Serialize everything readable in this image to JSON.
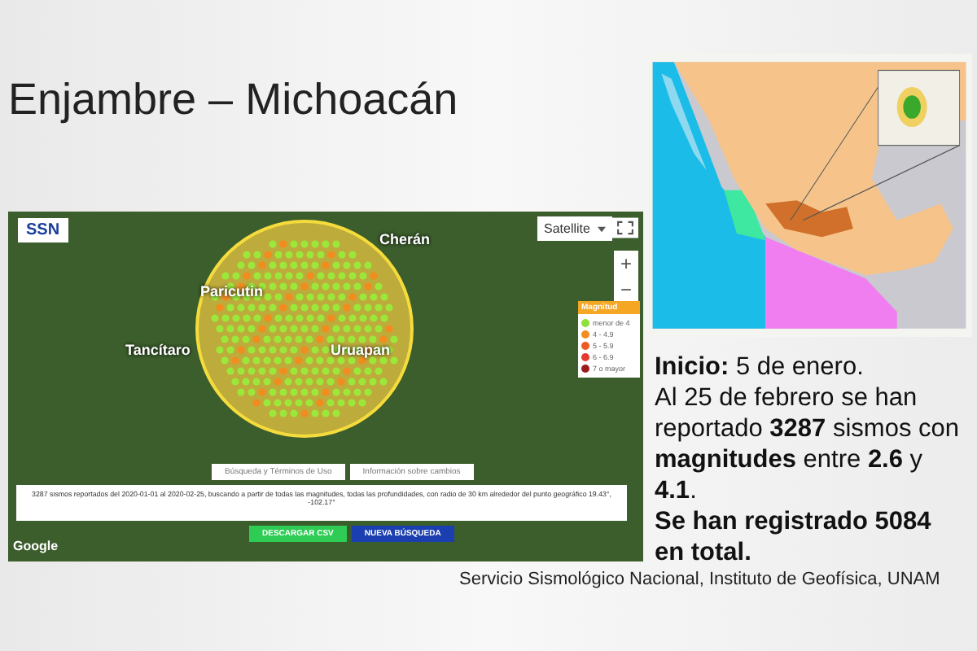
{
  "slide": {
    "title": "Enjambre – Michoacán",
    "seismic_map": {
      "logo": "SSN",
      "map_type": "Satellite",
      "zoom_in": "+",
      "zoom_out": "−",
      "places": [
        "Cherán",
        "Paricutin",
        "Tancítaro",
        "Uruapan"
      ],
      "legend": {
        "title": "Magnitud",
        "items": [
          {
            "label": "menor de 4",
            "color": "#8ee03a"
          },
          {
            "label": "4 - 4.9",
            "color": "#f28c1e"
          },
          {
            "label": "5 - 5.9",
            "color": "#ee5a24"
          },
          {
            "label": "6 - 6.9",
            "color": "#e53a2f"
          },
          {
            "label": "7 o mayor",
            "color": "#9b1c1c"
          }
        ]
      },
      "links": [
        "Búsqueda y Términos de Uso",
        "Información sobre cambios"
      ],
      "summary": "3287 sismos reportados del 2020-01-01 al 2020-02-25, buscando a partir de todas las magnitudes, todas las profundidades, con radio de 30 km alrededor del punto geográfico 19.43°, -102.17°",
      "buttons": [
        {
          "label": "DESCARGAR CSV",
          "kind": "download"
        },
        {
          "label": "NUEVA BÚSQUEDA",
          "kind": "search"
        }
      ],
      "attribution": "Google"
    },
    "paragraphs": [
      {
        "text": "**Inicio:** 5 de enero.",
        "kind": "plain"
      },
      {
        "text": "Al 25 de febrero se han reportado **3287** sismos con **magnitudes** entre **2.6** y **4.1**.",
        "kind": "plain"
      },
      {
        "text": "Se han registrado 5084 en total.",
        "kind": "emphasis"
      }
    ],
    "credit": "Servicio Sismológico Nacional, Instituto de Geofísica, UNAM"
  }
}
